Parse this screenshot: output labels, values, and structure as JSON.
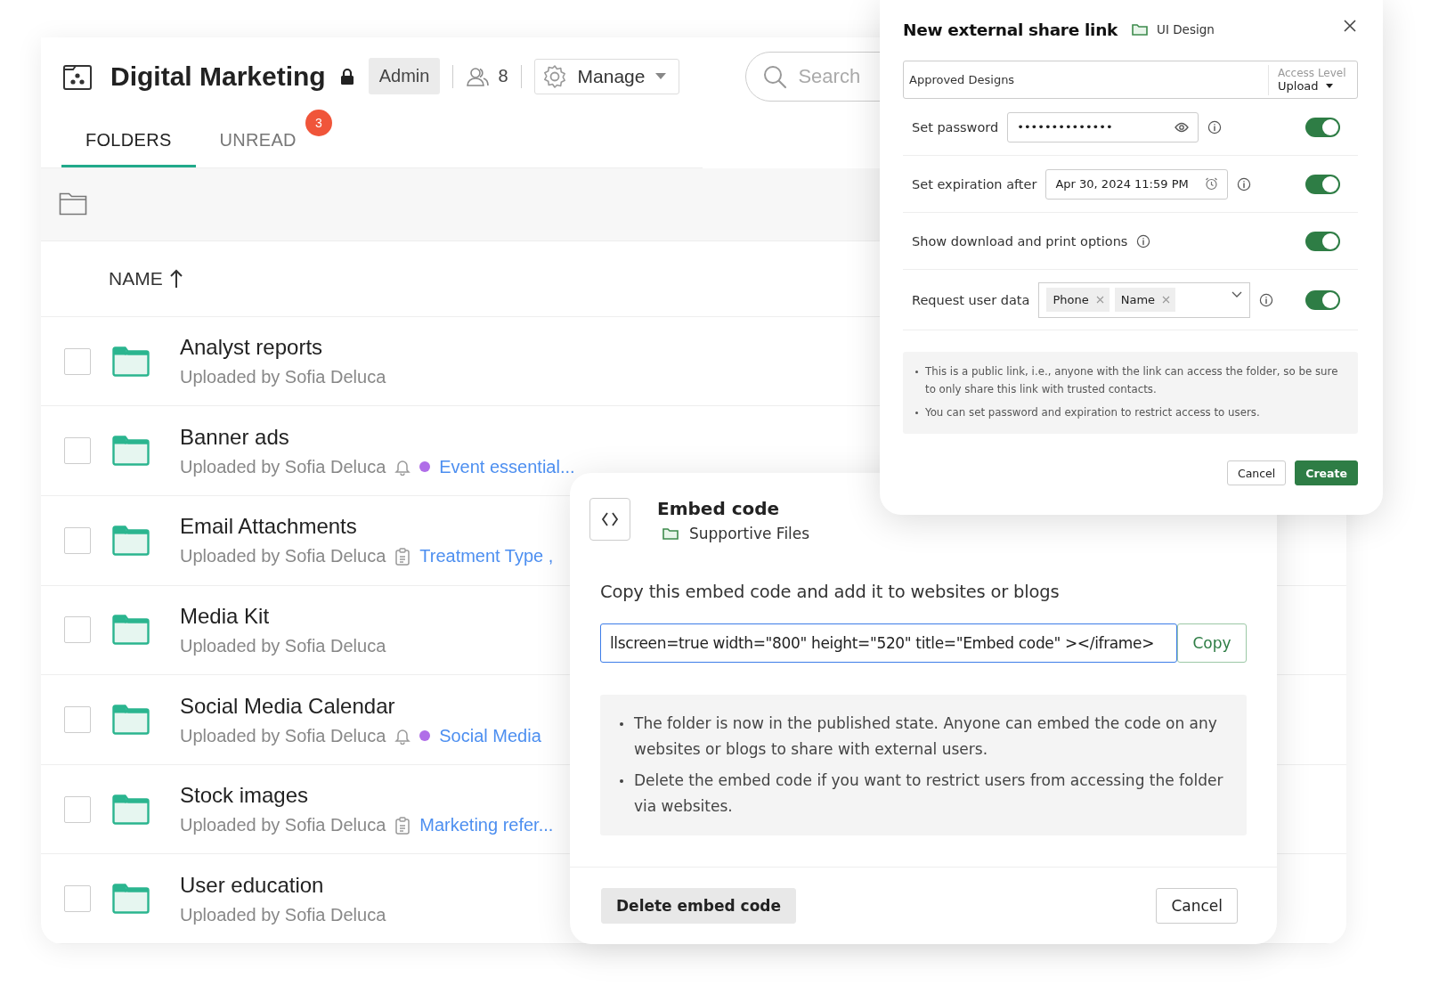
{
  "workspace": {
    "title": "Digital Marketing",
    "role": "Admin",
    "member_count": "8",
    "manage_label": "Manage",
    "search": {
      "placeholder": "Search"
    }
  },
  "tabs": [
    {
      "label": "FOLDERS",
      "selected": true
    },
    {
      "label": "UNREAD",
      "selected": false,
      "badge": "3"
    }
  ],
  "list_header": {
    "label": "NAME"
  },
  "folders": [
    {
      "name": "Analyst reports",
      "subtitle": "Uploaded by Sofia Deluca",
      "checked": false
    },
    {
      "name": "Banner ads",
      "subtitle": "Uploaded by Sofia Deluca",
      "checked": false,
      "meta": {
        "kind": "reminder",
        "tag": "Event essential..."
      }
    },
    {
      "name": "Email Attachments",
      "subtitle": "Uploaded by Sofia Deluca",
      "checked": false,
      "meta": {
        "kind": "form",
        "tag": "Treatment Type ,"
      }
    },
    {
      "name": "Media Kit",
      "subtitle": "Uploaded by Sofia Deluca",
      "checked": false
    },
    {
      "name": "Social Media Calendar",
      "subtitle": "Uploaded by Sofia Deluca",
      "checked": false,
      "meta": {
        "kind": "reminder",
        "tag": "Social Media"
      }
    },
    {
      "name": "Stock images",
      "subtitle": "Uploaded by Sofia Deluca",
      "checked": false,
      "meta": {
        "kind": "form",
        "tag": "Marketing refer..."
      }
    },
    {
      "name": "User education",
      "subtitle": "Uploaded by Sofia Deluca",
      "checked": false
    }
  ],
  "share_dialog": {
    "title": "New external share link",
    "folder": "UI Design",
    "link_name": "Approved Designs",
    "access_level_label": "Access Level",
    "access_level": "Upload",
    "options": [
      {
        "kind": "password",
        "label": "Set password",
        "value": "••••••••••••••",
        "on": true
      },
      {
        "kind": "date",
        "label": "Set expiration after",
        "value": "Apr 30, 2024 11:59 PM",
        "on": true
      },
      {
        "kind": "plain",
        "label": "Show download and print options",
        "on": true
      },
      {
        "kind": "tags",
        "label": "Request user data",
        "tags": [
          "Phone",
          "Name"
        ],
        "on": true
      }
    ],
    "notes": [
      "This is a public link, i.e., anyone with the link can access the folder, so be sure to only share this link with trusted contacts.",
      "You can set password and expiration to restrict access to users."
    ],
    "buttons": [
      "Cancel",
      "Create"
    ]
  },
  "embed_dialog": {
    "title": "Embed code",
    "folder": "Supportive Files",
    "instruction": "Copy this embed code and add it to websites or blogs",
    "code": "llscreen=true width=\"800\" height=\"520\" title=\"Embed code\" ></iframe>",
    "copy_label": "Copy",
    "notes": [
      "The folder is now in the published state. Anyone can embed the code on any websites or blogs to share with external users.",
      "Delete the embed code if you want to restrict users from accessing the folder via websites."
    ],
    "buttons": [
      "Delete embed code",
      "Cancel"
    ]
  }
}
